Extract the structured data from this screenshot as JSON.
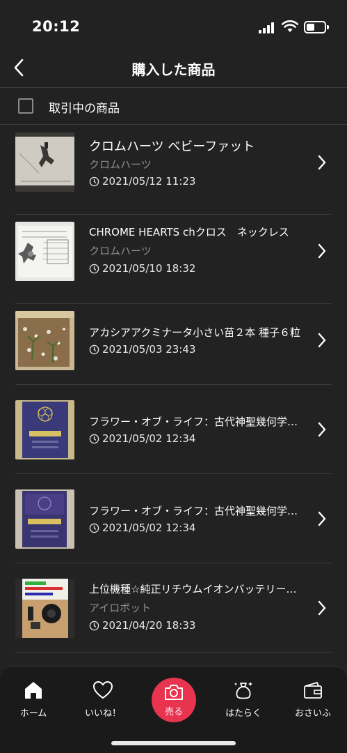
{
  "status_bar": {
    "time": "20:12"
  },
  "nav": {
    "title": "購入した商品"
  },
  "filter": {
    "label": "取引中の商品",
    "checked": false
  },
  "items": [
    {
      "title": "クロムハーツ ベビーファット",
      "seller": "クロムハーツ",
      "date": "2021/05/12 11:23"
    },
    {
      "title": "CHROME HEARTS  chクロス　ネックレス",
      "seller": "クロムハーツ",
      "date": "2021/05/10 18:32"
    },
    {
      "title": "アカシアアクミナータ小さい苗２本 種子６粒",
      "seller": "",
      "date": "2021/05/03 23:43"
    },
    {
      "title": "フラワー・オブ・ライフ：古代神聖幾何学の秘密",
      "seller": "",
      "date": "2021/05/02 12:34"
    },
    {
      "title": "フラワー・オブ・ライフ：古代神聖幾何学の秘密",
      "seller": "",
      "date": "2021/05/02 12:34"
    },
    {
      "title": "上位機種☆純正リチウムイオンバッテリー搭載",
      "seller": "アイロボット",
      "date": "2021/04/20 18:33"
    }
  ],
  "tabs": {
    "home": "ホーム",
    "likes": "いいね！",
    "sell": "売る",
    "work": "はたらく",
    "wallet": "おさいふ"
  },
  "colors": {
    "background": "#222222",
    "accent": "#e8344e",
    "secondary_text": "#8f8f8f"
  }
}
